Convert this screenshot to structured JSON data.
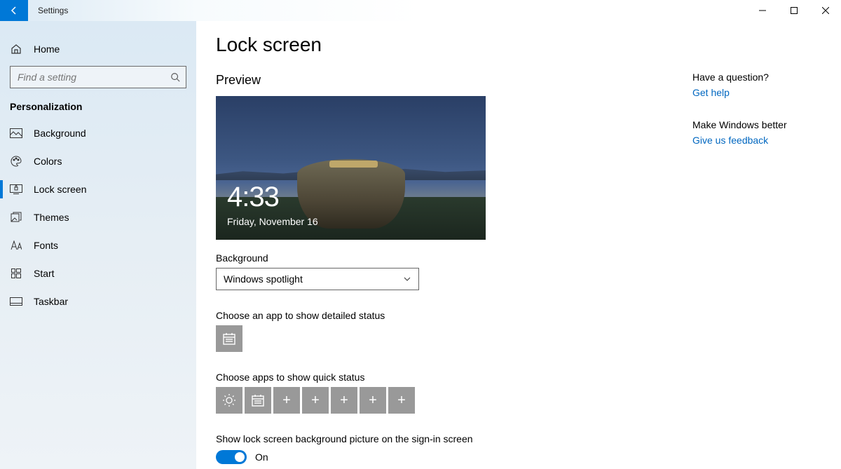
{
  "app_title": "Settings",
  "window": {
    "minimize": "–",
    "maximize": "□",
    "close": "✕"
  },
  "sidebar": {
    "home": "Home",
    "search_placeholder": "Find a setting",
    "section": "Personalization",
    "items": [
      {
        "label": "Background",
        "icon": "picture"
      },
      {
        "label": "Colors",
        "icon": "palette"
      },
      {
        "label": "Lock screen",
        "icon": "lock-screen",
        "active": true
      },
      {
        "label": "Themes",
        "icon": "themes"
      },
      {
        "label": "Fonts",
        "icon": "fonts"
      },
      {
        "label": "Start",
        "icon": "start"
      },
      {
        "label": "Taskbar",
        "icon": "taskbar"
      }
    ]
  },
  "page": {
    "title": "Lock screen",
    "preview_heading": "Preview",
    "preview_time": "4:33",
    "preview_date": "Friday, November 16",
    "background_label": "Background",
    "background_select": "Windows spotlight",
    "detailed_label": "Choose an app to show detailed status",
    "quick_label": "Choose apps to show quick status",
    "show_bg_label": "Show lock screen background picture on the sign-in screen",
    "toggle_state": "On"
  },
  "aside": {
    "q1": "Have a question?",
    "link1": "Get help",
    "q2": "Make Windows better",
    "link2": "Give us feedback"
  }
}
